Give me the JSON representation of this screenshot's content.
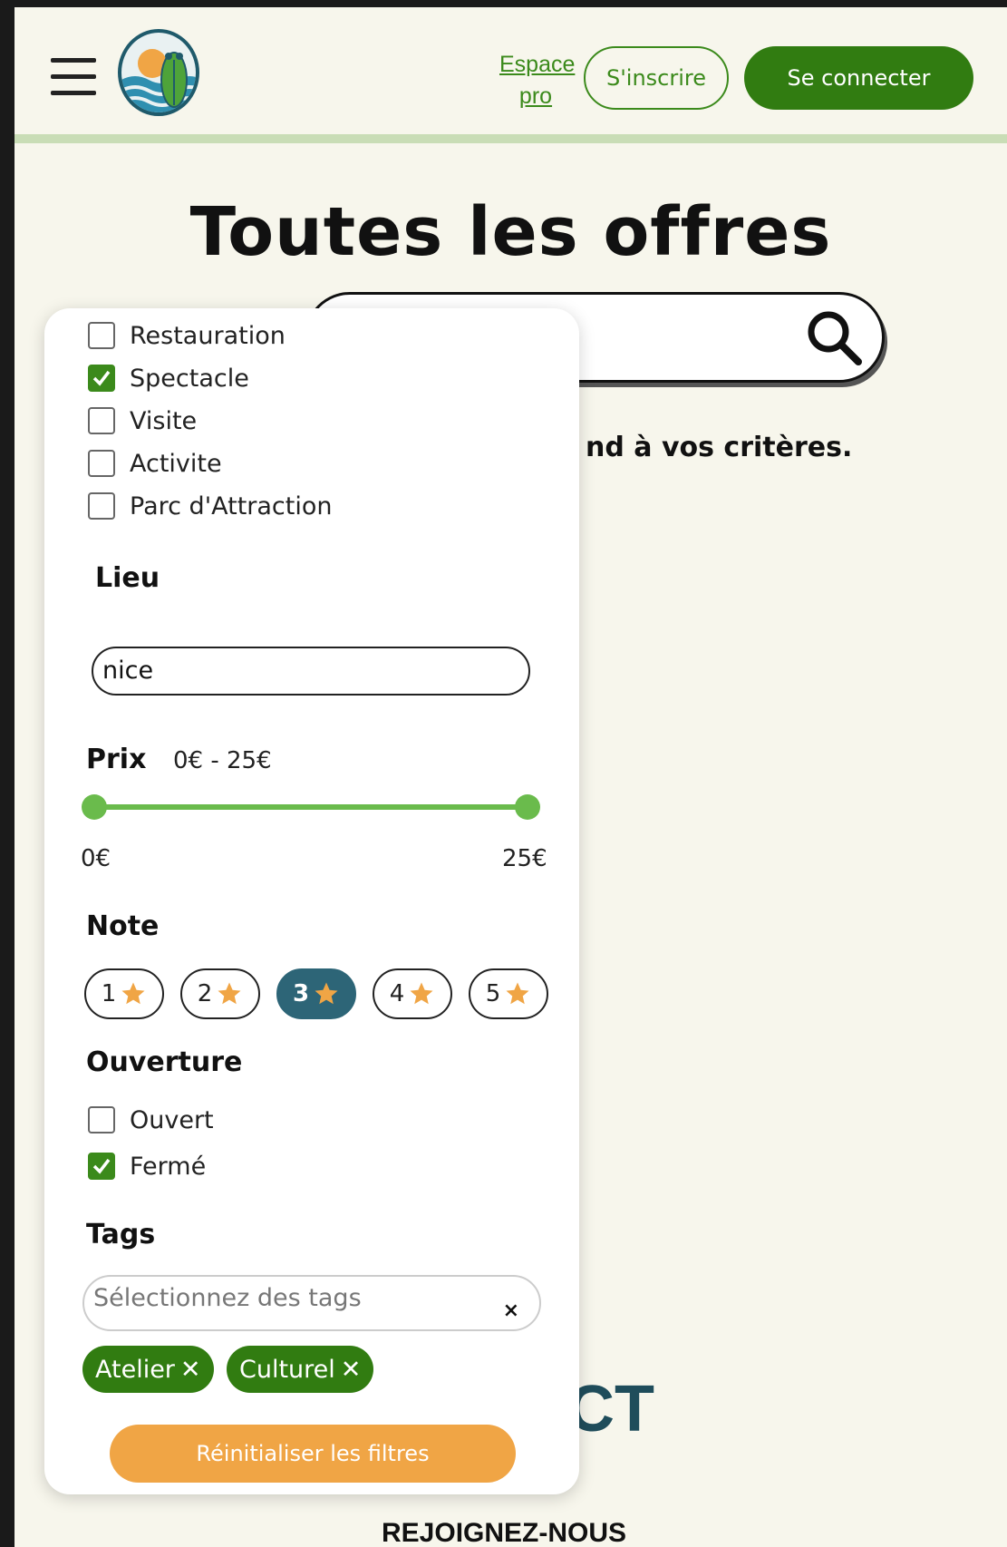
{
  "header": {
    "espace_pro": "Espace pro",
    "signup_label": "S'inscrire",
    "login_label": "Se connecter"
  },
  "main": {
    "title": "Toutes les offres",
    "no_result_text": "nd à vos critères.",
    "contact_text": "CT",
    "footer_heading": "REJOIGNEZ-NOUS"
  },
  "filters": {
    "categories": [
      {
        "label": "Restauration",
        "checked": false
      },
      {
        "label": "Spectacle",
        "checked": true
      },
      {
        "label": "Visite",
        "checked": false
      },
      {
        "label": "Activite",
        "checked": false
      },
      {
        "label": "Parc d'Attraction",
        "checked": false
      }
    ],
    "lieu": {
      "title": "Lieu",
      "value": "nice"
    },
    "prix": {
      "title": "Prix",
      "range_text": "0€ - 25€",
      "min_label": "0€",
      "max_label": "25€",
      "min": 0,
      "max": 25
    },
    "note": {
      "title": "Note",
      "options": [
        "1",
        "2",
        "3",
        "4",
        "5"
      ],
      "selected": "3"
    },
    "ouverture": {
      "title": "Ouverture",
      "options": [
        {
          "label": "Ouvert",
          "checked": false
        },
        {
          "label": "Fermé",
          "checked": true
        }
      ]
    },
    "tags": {
      "title": "Tags",
      "placeholder": "Sélectionnez des tags",
      "clear_symbol": "×",
      "selected": [
        "Atelier",
        "Culturel"
      ],
      "remove_symbol": "✕"
    },
    "reset_label": "Réinitialiser les filtres"
  },
  "colors": {
    "brand_green": "#317c11",
    "accent_orange": "#f0a545",
    "active_note": "#2d6577",
    "slider_green": "#6abb4c",
    "star": "#f0a545"
  }
}
